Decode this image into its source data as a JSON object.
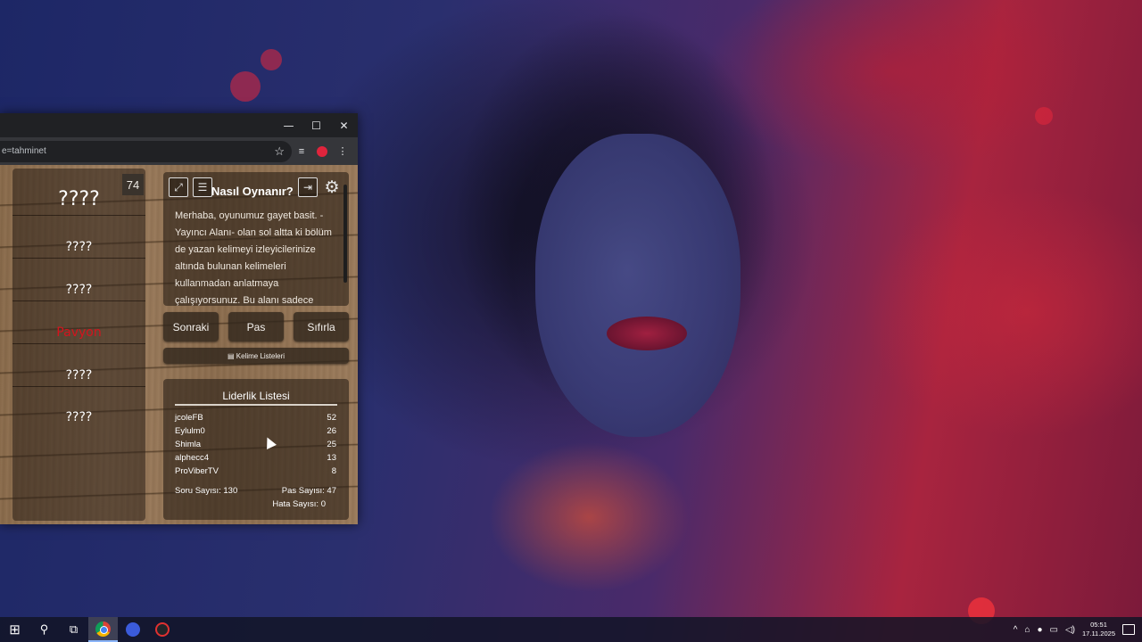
{
  "browser": {
    "url": "e=tahminet",
    "window_controls": {
      "minimize": "—",
      "maximize": "☐",
      "close": "✕"
    }
  },
  "game": {
    "counter": "74",
    "target_word": "????",
    "forbidden_words": [
      "????",
      "????",
      "Pavyon",
      "????",
      "????"
    ],
    "how_to": {
      "title": "Nasıl Oynanır?",
      "text": "Merhaba, oyunumuz gayet basit. -Yayıncı Alanı- olan sol altta ki bölüm de yazan kelimeyi izleyicilerinize altında bulunan kelimeleri kullanmadan anlatmaya çalışıyorsunuz. Bu alanı sadece"
    },
    "buttons": {
      "next": "Sonraki",
      "pass": "Pas",
      "reset": "Sıfırla",
      "word_lists": "Kelime Listeleri"
    },
    "leaderboard": {
      "title": "Liderlik Listesi",
      "rows": [
        {
          "name": "jcoleFB",
          "score": "52"
        },
        {
          "name": "Eylulm0",
          "score": "26"
        },
        {
          "name": "Shimla",
          "score": "25"
        },
        {
          "name": "alphecc4",
          "score": "13"
        },
        {
          "name": "ProViberTV",
          "score": "8"
        }
      ],
      "question_count": "Soru Sayısı: 130",
      "pass_count": "Pas Sayısı: 47",
      "error_count": "Hata Sayısı: 0"
    }
  },
  "taskbar": {
    "time": "05:51",
    "date": "17.11.2025"
  }
}
